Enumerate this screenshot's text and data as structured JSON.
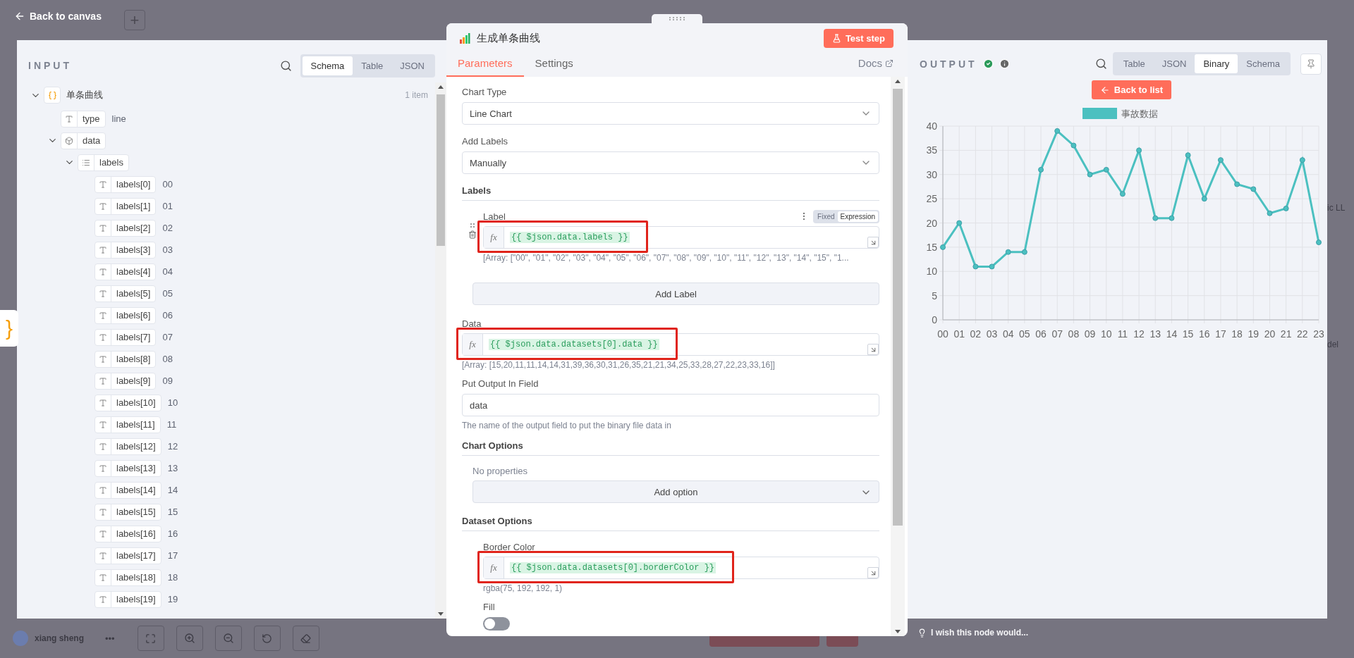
{
  "top_bar": {
    "back_link": "Back to canvas",
    "add_button": "+"
  },
  "side_tab": {
    "glyph": "}"
  },
  "input_panel": {
    "title": "INPUT",
    "view_tabs": [
      {
        "label": "Schema",
        "selected": true
      },
      {
        "label": "Table",
        "selected": false
      },
      {
        "label": "JSON",
        "selected": false
      }
    ],
    "tree": [
      {
        "kind": "object",
        "key": "单条曲线",
        "count": "1 item",
        "expanded": true,
        "children": [
          {
            "kind": "string",
            "key": "type",
            "value": "line"
          },
          {
            "kind": "box",
            "key": "data",
            "expanded": true,
            "children": [
              {
                "kind": "list",
                "key": "labels",
                "expanded": true,
                "children": [
                  {
                    "kind": "string",
                    "key": "labels[0]",
                    "value": "00"
                  },
                  {
                    "kind": "string",
                    "key": "labels[1]",
                    "value": "01"
                  },
                  {
                    "kind": "string",
                    "key": "labels[2]",
                    "value": "02"
                  },
                  {
                    "kind": "string",
                    "key": "labels[3]",
                    "value": "03"
                  },
                  {
                    "kind": "string",
                    "key": "labels[4]",
                    "value": "04"
                  },
                  {
                    "kind": "string",
                    "key": "labels[5]",
                    "value": "05"
                  },
                  {
                    "kind": "string",
                    "key": "labels[6]",
                    "value": "06"
                  },
                  {
                    "kind": "string",
                    "key": "labels[7]",
                    "value": "07"
                  },
                  {
                    "kind": "string",
                    "key": "labels[8]",
                    "value": "08"
                  },
                  {
                    "kind": "string",
                    "key": "labels[9]",
                    "value": "09"
                  },
                  {
                    "kind": "string",
                    "key": "labels[10]",
                    "value": "10"
                  },
                  {
                    "kind": "string",
                    "key": "labels[11]",
                    "value": "11"
                  },
                  {
                    "kind": "string",
                    "key": "labels[12]",
                    "value": "12"
                  },
                  {
                    "kind": "string",
                    "key": "labels[13]",
                    "value": "13"
                  },
                  {
                    "kind": "string",
                    "key": "labels[14]",
                    "value": "14"
                  },
                  {
                    "kind": "string",
                    "key": "labels[15]",
                    "value": "15"
                  },
                  {
                    "kind": "string",
                    "key": "labels[16]",
                    "value": "16"
                  },
                  {
                    "kind": "string",
                    "key": "labels[17]",
                    "value": "17"
                  },
                  {
                    "kind": "string",
                    "key": "labels[18]",
                    "value": "18"
                  },
                  {
                    "kind": "string",
                    "key": "labels[19]",
                    "value": "19"
                  }
                ]
              }
            ]
          }
        ]
      }
    ]
  },
  "node_panel": {
    "title": "生成单条曲线",
    "test_button": "Test step",
    "tabs": [
      {
        "label": "Parameters",
        "selected": true
      },
      {
        "label": "Settings",
        "selected": false
      }
    ],
    "docs_link": "Docs",
    "fields": [
      {
        "kind": "select",
        "label": "Chart Type",
        "value": "Line Chart"
      },
      {
        "kind": "select",
        "label": "Add Labels",
        "value": "Manually"
      },
      {
        "kind": "section",
        "label": "Labels"
      },
      {
        "kind": "expression",
        "label": "Label",
        "prefix": "fx",
        "value": "{{ $json.data.labels }}",
        "hint": "[Array: [\"00\", \"01\", \"02\", \"03\", \"04\", \"05\", \"06\", \"07\", \"08\", \"09\", \"10\", \"11\", \"12\", \"13\", \"14\", \"15\", \"1...",
        "indented": true,
        "removable": true,
        "highlighted": true,
        "mode_tabs": [
          {
            "label": "Fixed",
            "selected": false
          },
          {
            "label": "Expression",
            "selected": true
          }
        ]
      },
      {
        "kind": "button",
        "label": "Add Label"
      },
      {
        "kind": "expression",
        "label": "Data",
        "prefix": "fx",
        "value": "{{ $json.data.datasets[0].data }}",
        "hint": "[Array: [15,20,11,11,14,14,31,39,36,30,31,26,35,21,21,34,25,33,28,27,22,23,33,16]]",
        "indented": false,
        "removable": false,
        "highlighted": true
      },
      {
        "kind": "text",
        "label": "Put Output In Field",
        "value": "data",
        "hint": "The name of the output field to put the binary file data in"
      },
      {
        "kind": "section",
        "label": "Chart Options"
      },
      {
        "kind": "note",
        "label": "No properties"
      },
      {
        "kind": "dropdown_button",
        "label": "Add option"
      },
      {
        "kind": "section",
        "label": "Dataset Options"
      },
      {
        "kind": "expression",
        "label": "Border Color",
        "prefix": "fx",
        "value": "{{ $json.data.datasets[0].borderColor }}",
        "hint": "rgba(75, 192, 192, 1)",
        "indented": true,
        "removable": false,
        "highlighted": true
      },
      {
        "kind": "toggle",
        "label": "Fill",
        "on": false
      }
    ]
  },
  "output_panel": {
    "title": "OUTPUT",
    "success": true,
    "view_tabs": [
      {
        "label": "Table",
        "selected": false
      },
      {
        "label": "JSON",
        "selected": false
      },
      {
        "label": "Binary",
        "selected": true
      },
      {
        "label": "Schema",
        "selected": false
      }
    ],
    "back_button": "Back to list",
    "chart_data": {
      "type": "line",
      "categories": [
        "00",
        "01",
        "02",
        "03",
        "04",
        "05",
        "06",
        "07",
        "08",
        "09",
        "10",
        "11",
        "12",
        "13",
        "14",
        "15",
        "16",
        "17",
        "18",
        "19",
        "20",
        "21",
        "22",
        "23"
      ],
      "series": [
        {
          "name": "事故数据",
          "color": "#4bc0c0",
          "values": [
            15,
            20,
            11,
            11,
            14,
            14,
            31,
            39,
            36,
            30,
            31,
            26,
            35,
            21,
            21,
            34,
            25,
            33,
            28,
            27,
            22,
            23,
            33,
            16
          ]
        }
      ],
      "ylim": [
        0,
        40
      ],
      "yticks": [
        0,
        5,
        10,
        15,
        20,
        25,
        30,
        35,
        40
      ],
      "grid": true,
      "marker": "circle"
    }
  },
  "bottom_bar": {
    "user_name": "xiang sheng",
    "more": "•••",
    "feedback": "I wish this node would..."
  },
  "canvas_fragments": [
    "ic LL",
    "del"
  ]
}
